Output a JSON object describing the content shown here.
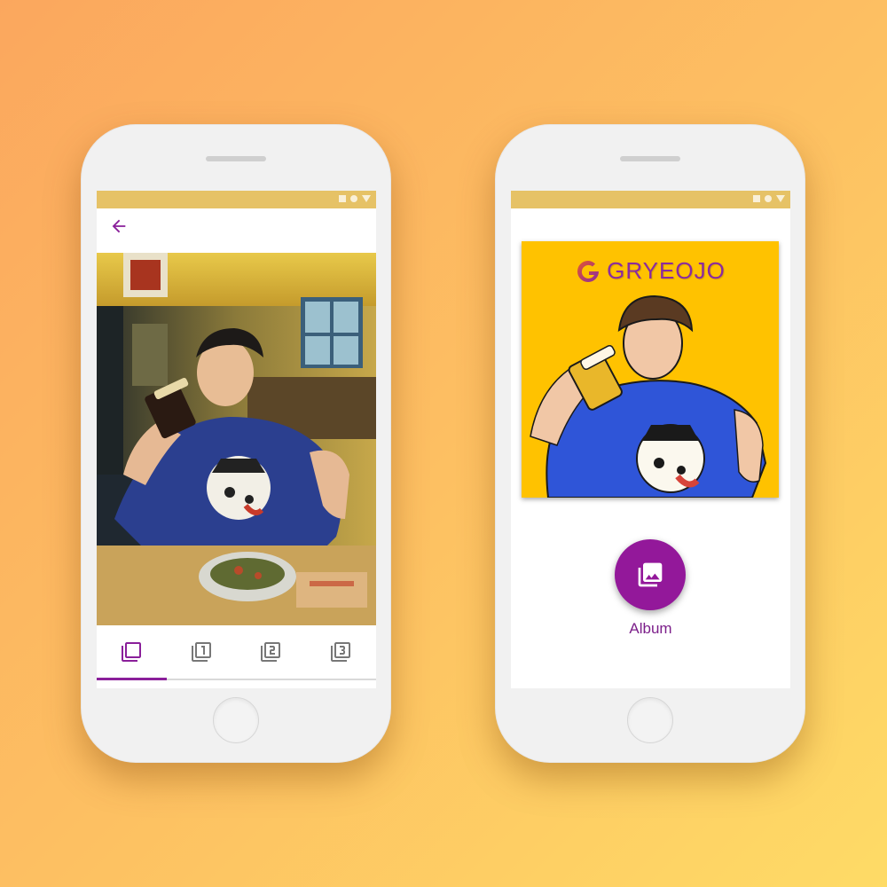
{
  "colors": {
    "accent": "#8a1f9a",
    "status_bar": "#e6c266",
    "art_background": "#ffc200",
    "fab": "#93189a"
  },
  "left_phone": {
    "toolbar": {
      "back_icon": "arrow-left-icon"
    },
    "tabs": [
      {
        "icon": "original-layers-icon",
        "selected": true
      },
      {
        "icon": "filter-1-icon",
        "selected": false
      },
      {
        "icon": "filter-2-icon",
        "selected": false
      },
      {
        "icon": "filter-3-icon",
        "selected": false
      }
    ]
  },
  "right_phone": {
    "brand": "GRYEOJO",
    "album_button": {
      "icon": "photo-album-icon",
      "label": "Album"
    }
  }
}
